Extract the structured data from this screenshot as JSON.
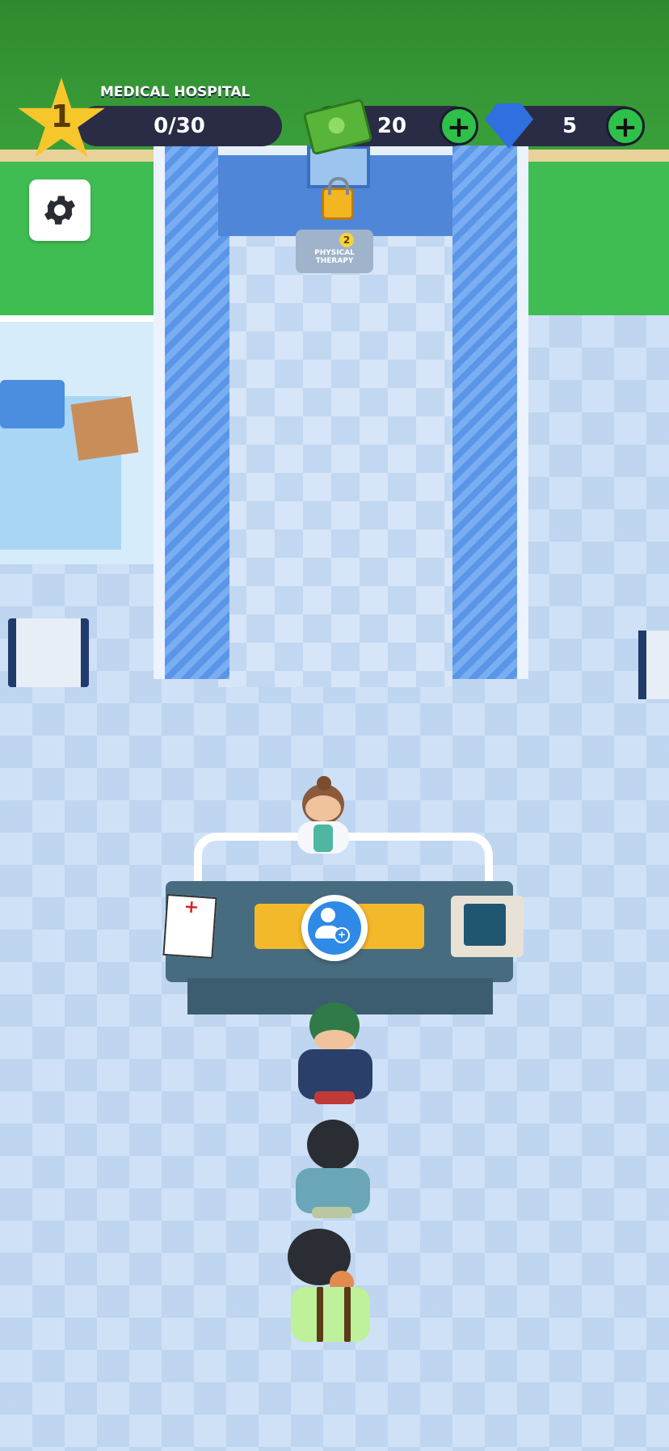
{
  "hud": {
    "level": "1",
    "hospital_name": "MEDICAL HOSPITAL",
    "patients_progress": "0/30",
    "cash": "20",
    "gems": "5",
    "add_cash_label": "+",
    "add_gems_label": "+"
  },
  "map": {
    "locked_room_label": "PHYSICAL THERAPY",
    "locked_room_level_badge": "2"
  },
  "icons": {
    "settings": "gear-icon",
    "cash": "cash-icon",
    "gem": "gem-icon",
    "level": "star-icon",
    "lock": "lock-icon",
    "assign": "add-user-icon"
  },
  "colors": {
    "hud_bar": "#2a2c45",
    "plus_button": "#2ec14a",
    "star": "#f6c62a",
    "floor": "#cfe1f6",
    "desk_pad": "#f4b82b",
    "assign_button": "#2e8ae6"
  },
  "queue": {
    "patients_waiting": 3
  }
}
